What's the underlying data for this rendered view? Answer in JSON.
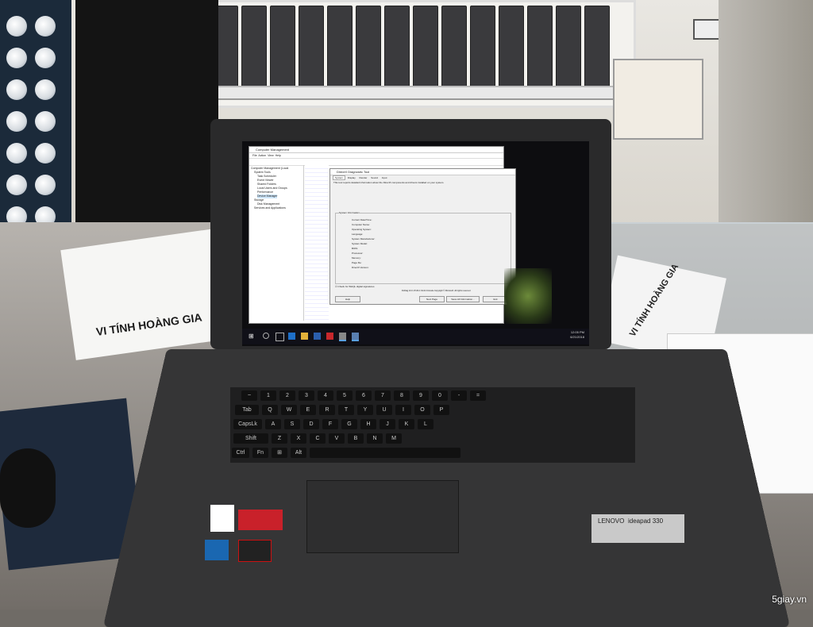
{
  "computer_management": {
    "title": "Computer Management",
    "menu": [
      "File",
      "Action",
      "View",
      "Help"
    ],
    "tree": [
      "Computer Management (Local",
      "System Tools",
      "Task Scheduler",
      "Event Viewer",
      "Shared Folders",
      "Local Users and Groups",
      "Performance",
      "Device Manager",
      "Storage",
      "Disk Management",
      "Services and Applications"
    ]
  },
  "dxdiag": {
    "title": "DirectX Diagnostic Tool",
    "tabs": [
      "System",
      "Display",
      "Render",
      "Sound",
      "Input"
    ],
    "intro": "This tool reports detailed information about the DirectX components and drivers installed on your system.",
    "section": "System Information",
    "fields": [
      {
        "label": "Current Date/Time:",
        "value": ""
      },
      {
        "label": "Computer Name:",
        "value": ""
      },
      {
        "label": "Operating System:",
        "value": ""
      },
      {
        "label": "Language:",
        "value": ""
      },
      {
        "label": "System Manufacturer:",
        "value": ""
      },
      {
        "label": "System Model:",
        "value": ""
      },
      {
        "label": "BIOS:",
        "value": ""
      },
      {
        "label": "Processor:",
        "value": ""
      },
      {
        "label": "Memory:",
        "value": ""
      },
      {
        "label": "Page file:",
        "value": ""
      },
      {
        "label": "DirectX Version:",
        "value": ""
      }
    ],
    "checkbox": "Check for WHQL digital signatures",
    "footer_note": "DxDiag 10.0.17134.1 64-bit Unicode Copyright © Microsoft. All rights reserved.",
    "buttons": {
      "help": "Help",
      "next": "Next Page",
      "save": "Save All Information...",
      "exit": "Exit"
    }
  },
  "taskbar": {
    "time": "12:05 PM",
    "date": "6/21/2018"
  },
  "laptop": {
    "brand": "LENOVO",
    "model": "ideapad 330"
  },
  "keyboard": {
    "row1": [
      "~",
      "1",
      "2",
      "3",
      "4",
      "5",
      "6",
      "7",
      "8",
      "9",
      "0",
      "-",
      "="
    ],
    "row2": [
      "Q",
      "W",
      "E",
      "R",
      "T",
      "Y",
      "U",
      "I",
      "O",
      "P"
    ],
    "row3": [
      "A",
      "S",
      "D",
      "F",
      "G",
      "H",
      "J",
      "K",
      "L"
    ],
    "row4": [
      "Z",
      "X",
      "C",
      "V",
      "B",
      "N",
      "M"
    ],
    "tab": "Tab",
    "caps": "CapsLk",
    "shift": "Shift",
    "ctrl": "Ctrl",
    "fn": "Fn",
    "alt": "Alt"
  },
  "papers": {
    "left": "VI TÍNH HOÀNG GIA",
    "right": "VI TÍNH HOÀNG GIA"
  },
  "watermark": "5giay.vn"
}
